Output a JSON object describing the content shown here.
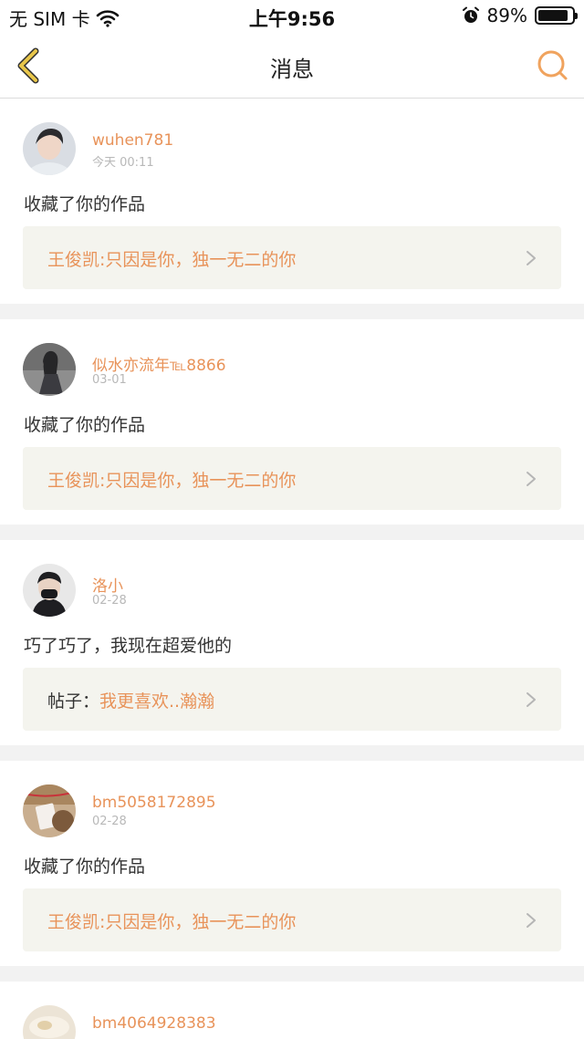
{
  "status_bar": {
    "carrier": "无 SIM 卡",
    "time": "上午9:56",
    "battery": "89%",
    "battery_level": 0.89
  },
  "nav": {
    "title": "消息",
    "back_icon": "chevron-left-icon",
    "search_icon": "search-icon"
  },
  "colors": {
    "accent": "#e8935a",
    "back_icon": "#e8c64a"
  },
  "messages": [
    {
      "username": "wuhen781",
      "time": "今天 00:11",
      "text": "收藏了你的作品",
      "ref_prefix": "",
      "ref_title": "王俊凯:只因是你，独一无二的你"
    },
    {
      "username": "似水亦流年℡8866",
      "time": "03-01",
      "text": "收藏了你的作品",
      "ref_prefix": "",
      "ref_title": "王俊凯:只因是你，独一无二的你"
    },
    {
      "username": "洛小",
      "time": "02-28",
      "text": "巧了巧了，我现在超爱他的",
      "ref_prefix": "帖子：",
      "ref_title": "我更喜欢..瀚瀚"
    },
    {
      "username": "bm5058172895",
      "time": "02-28",
      "text": "收藏了你的作品",
      "ref_prefix": "",
      "ref_title": "王俊凯:只因是你，独一无二的你"
    },
    {
      "username": "bm4064928383",
      "time": "",
      "text": "",
      "ref_prefix": "",
      "ref_title": ""
    }
  ]
}
